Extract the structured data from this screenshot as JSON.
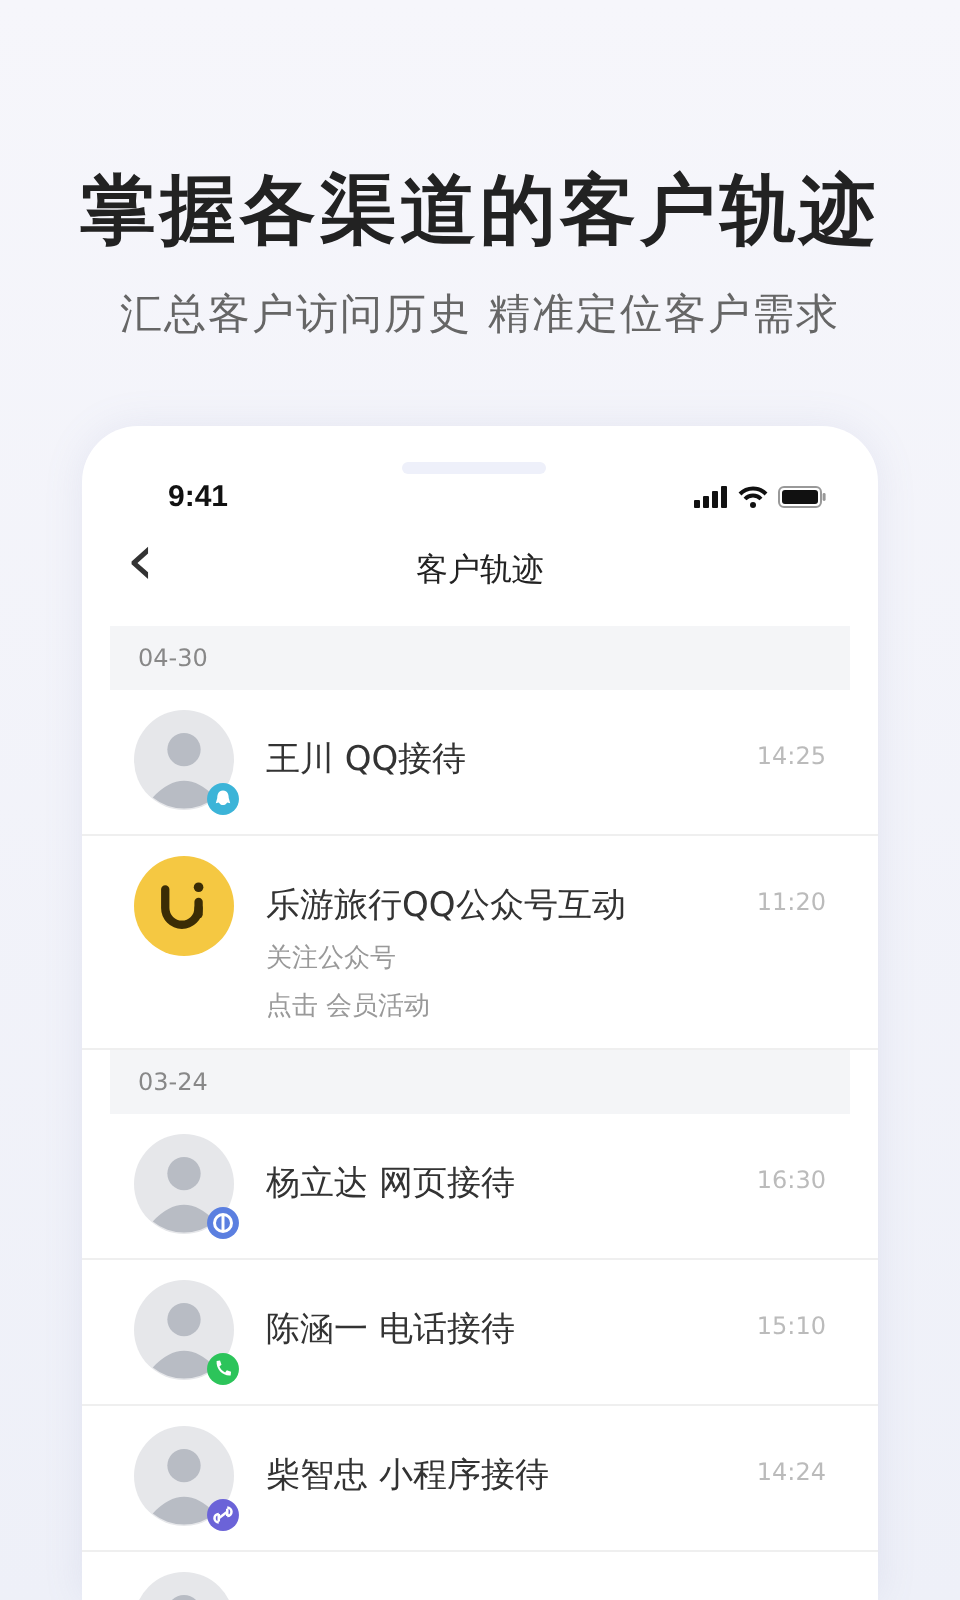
{
  "headline": "掌握各渠道的客户轨迹",
  "subtitle": "汇总客户访问历史 精准定位客户需求",
  "status_bar": {
    "time": "9:41"
  },
  "nav": {
    "back": "‹",
    "title": "客户轨迹"
  },
  "sections": [
    {
      "date": "04-30",
      "items": [
        {
          "kind": "person",
          "title": "王川 QQ接待",
          "time": "14:25",
          "channel": {
            "kind": "qq",
            "color": "#3cb4d8"
          }
        },
        {
          "kind": "logo",
          "title": "乐游旅行QQ公众号互动",
          "time": "11:20",
          "lines": [
            "关注公众号",
            "点击 会员活动"
          ]
        }
      ]
    },
    {
      "date": "03-24",
      "items": [
        {
          "kind": "person",
          "title": "杨立达 网页接待",
          "time": "16:30",
          "channel": {
            "kind": "web",
            "color": "#5b7fe0"
          }
        },
        {
          "kind": "person",
          "title": "陈涵一 电话接待",
          "time": "15:10",
          "channel": {
            "kind": "phone",
            "color": "#2cc45a"
          }
        },
        {
          "kind": "person",
          "title": "柴智忠 小程序接待",
          "time": "14:24",
          "channel": {
            "kind": "mini",
            "color": "#6b63d8"
          }
        }
      ]
    }
  ]
}
